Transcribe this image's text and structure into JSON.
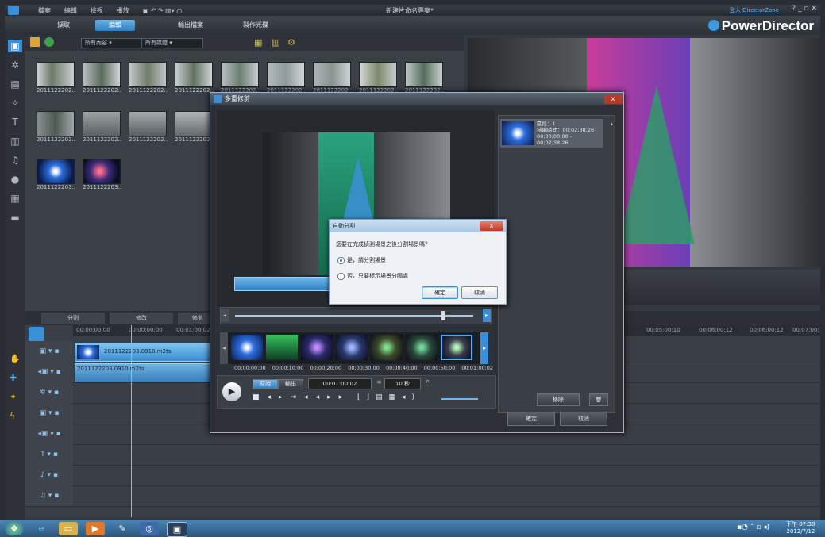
{
  "window": {
    "title": "新建片命名專案*",
    "menu": [
      "檔案",
      "編輯",
      "檢視",
      "播放"
    ],
    "user": "登入 DirectorZone",
    "brand": "PowerDirector",
    "tabs": [
      "擷取",
      "編輯",
      "輸出檔案",
      "製作光碟"
    ],
    "active_tab": "編輯"
  },
  "library": {
    "filter1": "所有內容",
    "filter2": "所有媒體",
    "rows": [
      [
        "2011122202..",
        "2011122202..",
        "2011122202..",
        "2011122202..",
        "2011122202..",
        "2011122202..",
        "2011122202..",
        "2011122202..",
        "2011122202.."
      ],
      [
        "2011122202..",
        "2011122202..",
        "2011122202..",
        "2011122202.."
      ],
      [
        "2011122203..",
        "2011122203.."
      ]
    ]
  },
  "timeline": {
    "tabs": [
      "分割",
      "修改",
      "修剪"
    ],
    "ruler": [
      "00;00;00;00",
      "00;00;00;00",
      "00;01;00;02",
      "00;05;00;10",
      "00;06;00;12",
      "00;06;00;12",
      "00;07;00;14"
    ],
    "clip1": "2011122203.0910.m2ts",
    "clip2": "2011122203.0910.m2ts"
  },
  "dialog": {
    "title": "多重修剪",
    "close": "x",
    "segment": {
      "label": "區段：1",
      "duration": "持續時間：00;02;38;26",
      "range": "00;00;00;00 - 00;02;38;26"
    },
    "film_times": [
      "00;00;00;00",
      "00;00;10;00",
      "00;00;20;00",
      "00;00;30;00",
      "00;00;40;00",
      "00;00;50;00",
      "00;01;00;02"
    ],
    "mode_a": "原始",
    "mode_b": "輸出",
    "timecode": "00:01:00:02",
    "step": "10 秒",
    "remove_button": "移除",
    "ok_button": "確定",
    "cancel_button": "取消"
  },
  "confirm": {
    "title": "自動分割",
    "close": "x",
    "question": "您要在完成偵測場景之後分割場景嗎？",
    "option_yes": "是，請分割場景",
    "option_no": "否，只要標示場景分隔處",
    "ok_button": "確定",
    "cancel_button": "取消"
  },
  "taskbar": {
    "time": "下午 07:30",
    "date": "2012/7/12"
  }
}
